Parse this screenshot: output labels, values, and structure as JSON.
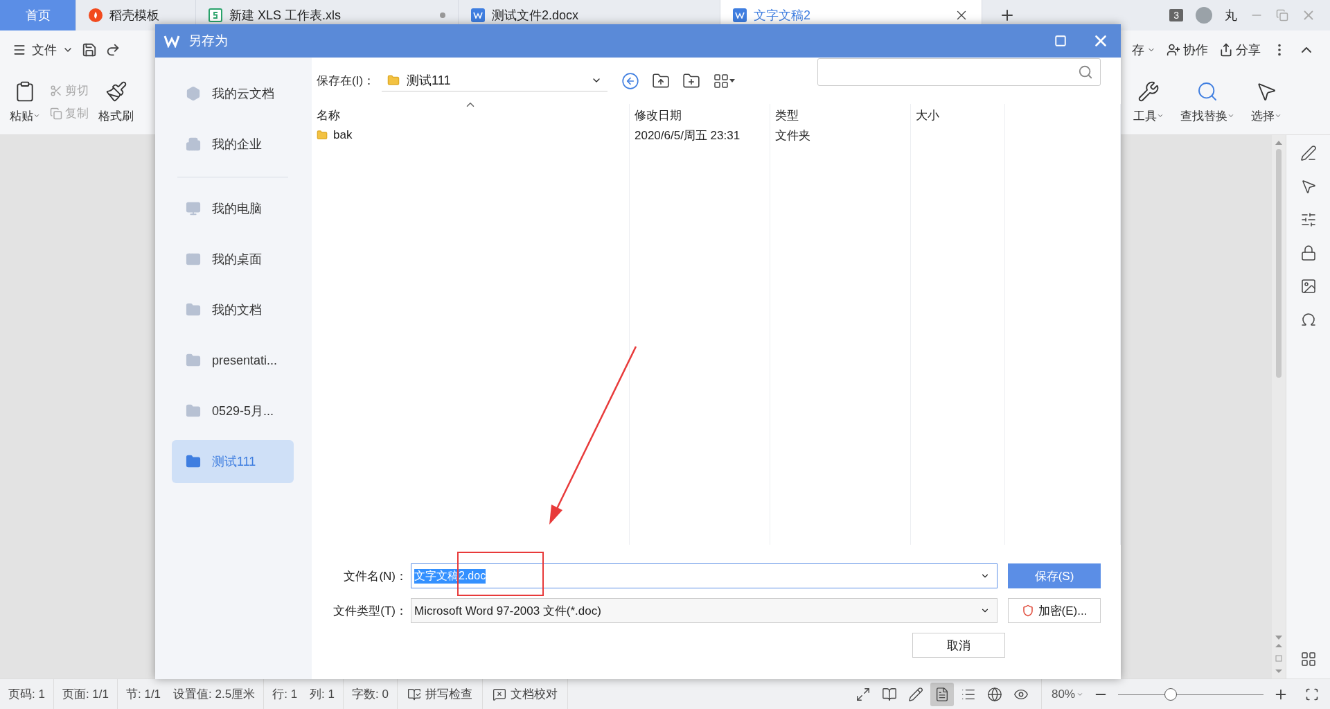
{
  "tabs": [
    {
      "label": "首页",
      "kind": "home",
      "selected": false,
      "modified": false
    },
    {
      "label": "稻壳模板",
      "kind": "docer",
      "selected": false,
      "modified": false
    },
    {
      "label": "新建 XLS 工作表.xls",
      "kind": "sheet",
      "selected": false,
      "modified": true
    },
    {
      "label": "测试文件2.docx",
      "kind": "writer",
      "selected": false,
      "modified": false
    },
    {
      "label": "文字文稿2",
      "kind": "writer",
      "selected": true,
      "modified": false
    }
  ],
  "tab_count": "3",
  "user": "丸",
  "quick_bar": {
    "file_menu": "文件",
    "right": [
      {
        "label": "存",
        "kind": "save"
      },
      {
        "label": "协作",
        "kind": "collab"
      },
      {
        "label": "分享",
        "kind": "share"
      }
    ]
  },
  "ribbon": {
    "left": [
      {
        "label": "粘贴",
        "kind": "paste",
        "disabled": false
      },
      {
        "label": "剪切",
        "kind": "cut",
        "disabled": true
      },
      {
        "label": "复制",
        "kind": "copy",
        "disabled": true
      },
      {
        "label": "格式刷",
        "kind": "brush",
        "disabled": false
      }
    ],
    "right": [
      {
        "label": "工具",
        "kind": "tools"
      },
      {
        "label": "查找替换",
        "kind": "find"
      },
      {
        "label": "选择",
        "kind": "select"
      }
    ]
  },
  "dialog": {
    "title": "另存为",
    "place_groups": [
      [
        {
          "label": "我的云文档",
          "kind": "cloud",
          "selected": false
        },
        {
          "label": "我的企业",
          "kind": "company",
          "selected": false
        }
      ],
      [
        {
          "label": "我的电脑",
          "kind": "computer",
          "selected": false
        },
        {
          "label": "我的桌面",
          "kind": "desktop",
          "selected": false
        },
        {
          "label": "我的文档",
          "kind": "folder",
          "selected": false
        },
        {
          "label": "presentati...",
          "kind": "folder",
          "selected": false
        },
        {
          "label": "0529-5月...",
          "kind": "folder",
          "selected": false
        },
        {
          "label": "测试111",
          "kind": "folder",
          "selected": true
        }
      ]
    ],
    "location_label": "保存在(I)：",
    "location": "测试111",
    "columns": [
      {
        "label": "名称",
        "sorted": true
      },
      {
        "label": "修改日期",
        "sorted": false
      },
      {
        "label": "类型",
        "sorted": false
      },
      {
        "label": "大小",
        "sorted": false
      }
    ],
    "rows": [
      {
        "name": "bak",
        "modified": "2020/6/5/周五 23:31",
        "type": "文件夹"
      }
    ],
    "filename_label": "文件名(N)：",
    "filename": "文字文稿2.doc",
    "filename_selected": true,
    "filetype_label": "文件类型(T)：",
    "filetype": "Microsoft Word 97-2003 文件(*.doc)",
    "buttons": [
      {
        "label": "保存(S)",
        "kind": "primary"
      },
      {
        "label": "加密(E)...",
        "kind": "encrypt"
      },
      {
        "label": "取消",
        "kind": "plain"
      }
    ]
  },
  "status_groups": [
    [
      "页码: 1"
    ],
    [
      "页面: 1/1"
    ],
    [
      "节: 1/1",
      "设置值: 2.5厘米"
    ],
    [
      "行: 1",
      "列: 1"
    ],
    [
      "字数: 0"
    ]
  ],
  "status_tools": [
    {
      "label": "拼写检查",
      "kind": "spell"
    },
    {
      "label": "文档校对",
      "kind": "proofread"
    }
  ],
  "views": [
    {
      "kind": "fullscreen",
      "selected": false
    },
    {
      "kind": "reading",
      "selected": false
    },
    {
      "kind": "edit",
      "selected": false
    },
    {
      "kind": "page",
      "selected": true
    },
    {
      "kind": "outline",
      "selected": false
    },
    {
      "kind": "web",
      "selected": false
    },
    {
      "kind": "eye",
      "selected": false
    }
  ],
  "zoom": {
    "label": "80%",
    "level": 0.36
  }
}
